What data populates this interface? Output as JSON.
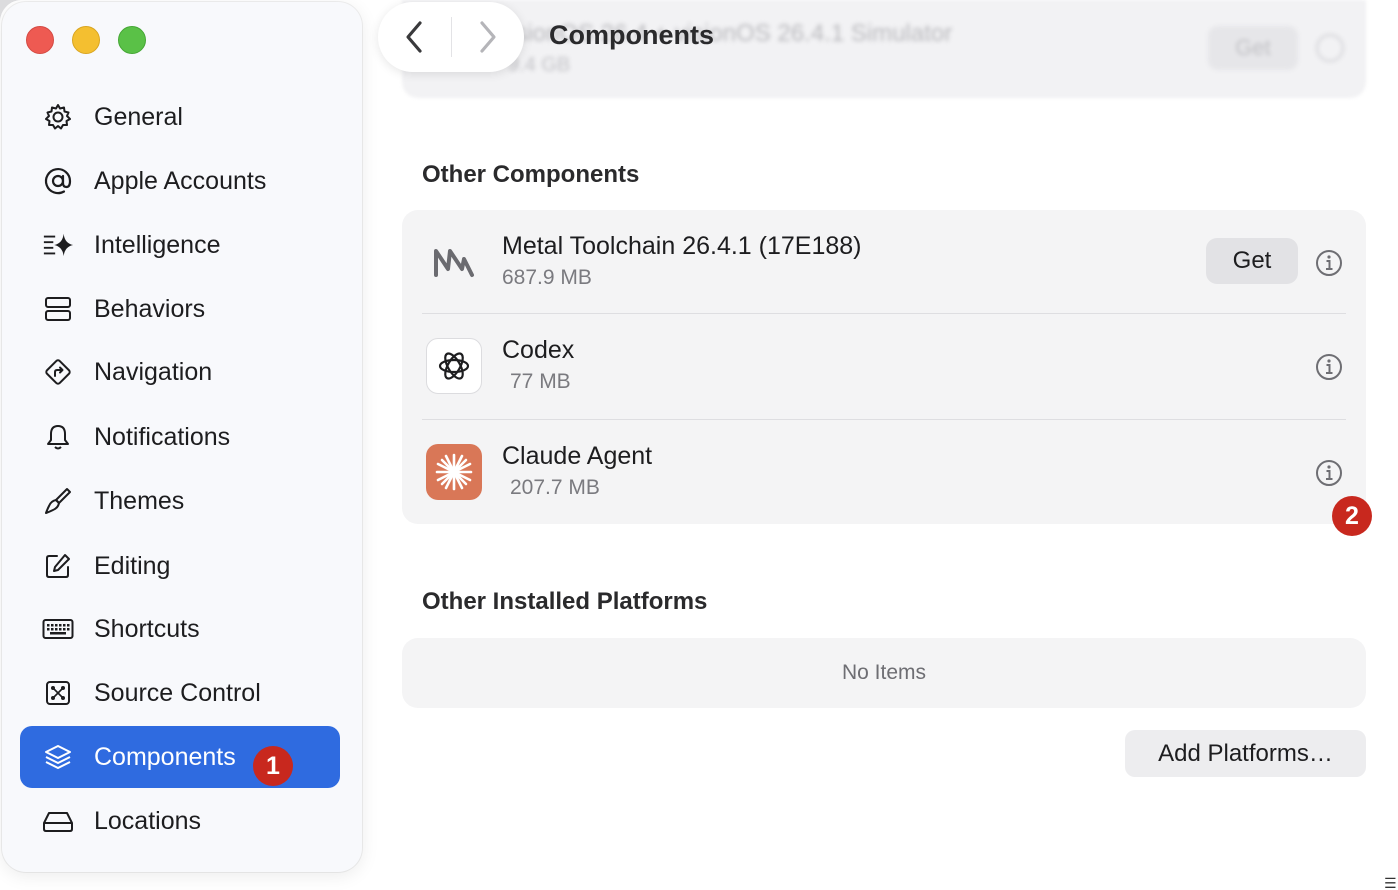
{
  "window": {
    "title": "Components",
    "blurred_header": {
      "title": "visionOS 26.4 + visionOS 26.4.1 Simulator",
      "size": "9.4 GB",
      "get_label": "Get"
    }
  },
  "sidebar": {
    "items": [
      {
        "label": "General",
        "icon": "gear-icon"
      },
      {
        "label": "Apple Accounts",
        "icon": "at-icon"
      },
      {
        "label": "Intelligence",
        "icon": "sparkle-icon"
      },
      {
        "label": "Behaviors",
        "icon": "behaviors-icon"
      },
      {
        "label": "Navigation",
        "icon": "navigation-icon"
      },
      {
        "label": "Notifications",
        "icon": "bell-icon"
      },
      {
        "label": "Themes",
        "icon": "paintbrush-icon"
      },
      {
        "label": "Editing",
        "icon": "edit-icon"
      },
      {
        "label": "Shortcuts",
        "icon": "keyboard-icon"
      },
      {
        "label": "Source Control",
        "icon": "source-control-icon"
      },
      {
        "label": "Components",
        "icon": "layers-icon",
        "selected": true
      },
      {
        "label": "Locations",
        "icon": "drive-icon"
      }
    ]
  },
  "badges": {
    "one": "1",
    "two": "2"
  },
  "other_components": {
    "title": "Other Components",
    "items": [
      {
        "name": "Metal Toolchain 26.4.1 (17E188)",
        "size": "687.9 MB",
        "get_label": "Get",
        "icon": "metal-icon"
      },
      {
        "name": "Codex",
        "size": "77 MB",
        "icon": "codex-icon"
      },
      {
        "name": "Claude Agent",
        "size": "207.7 MB",
        "icon": "claude-icon"
      }
    ]
  },
  "other_platforms": {
    "title": "Other Installed Platforms",
    "empty_text": "No Items",
    "add_label": "Add Platforms…"
  },
  "colors": {
    "accent": "#2f6be0",
    "badge": "#c8281e",
    "claude": "#d97757"
  }
}
